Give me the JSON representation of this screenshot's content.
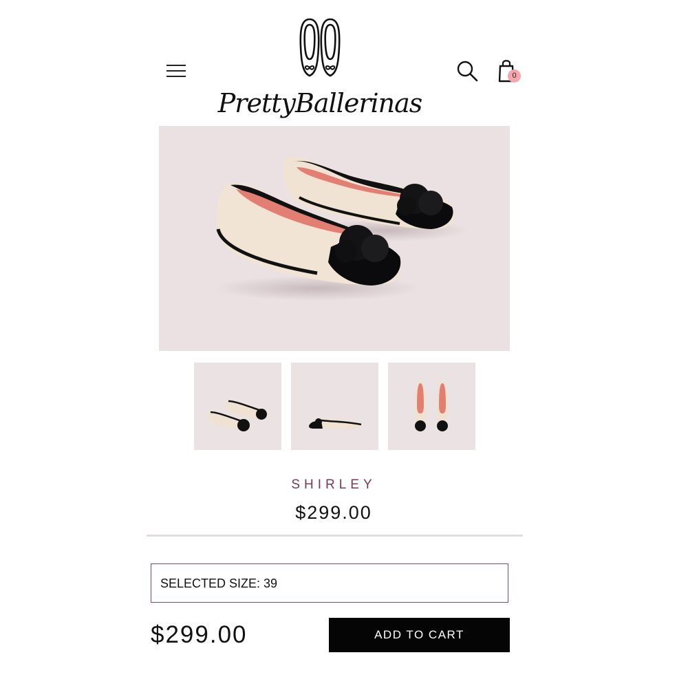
{
  "header": {
    "brand": "PrettyBallerinas",
    "cart_count": "0",
    "icons": [
      "menu-icon",
      "ballet-flats-logo-icon",
      "search-icon",
      "shopping-bag-icon"
    ]
  },
  "product": {
    "name": "SHIRLEY",
    "price": "$299.00",
    "image_count": 3
  },
  "size_selector": {
    "label": "SELECTED SIZE: 39"
  },
  "purchase_bar": {
    "price": "$299.00",
    "add_to_cart_label": "ADD TO CART"
  },
  "colors": {
    "accent": "#7a3a4c",
    "image_background": "#ebe1e2",
    "cart_badge": "#f3a7ad",
    "button": "#050505"
  }
}
